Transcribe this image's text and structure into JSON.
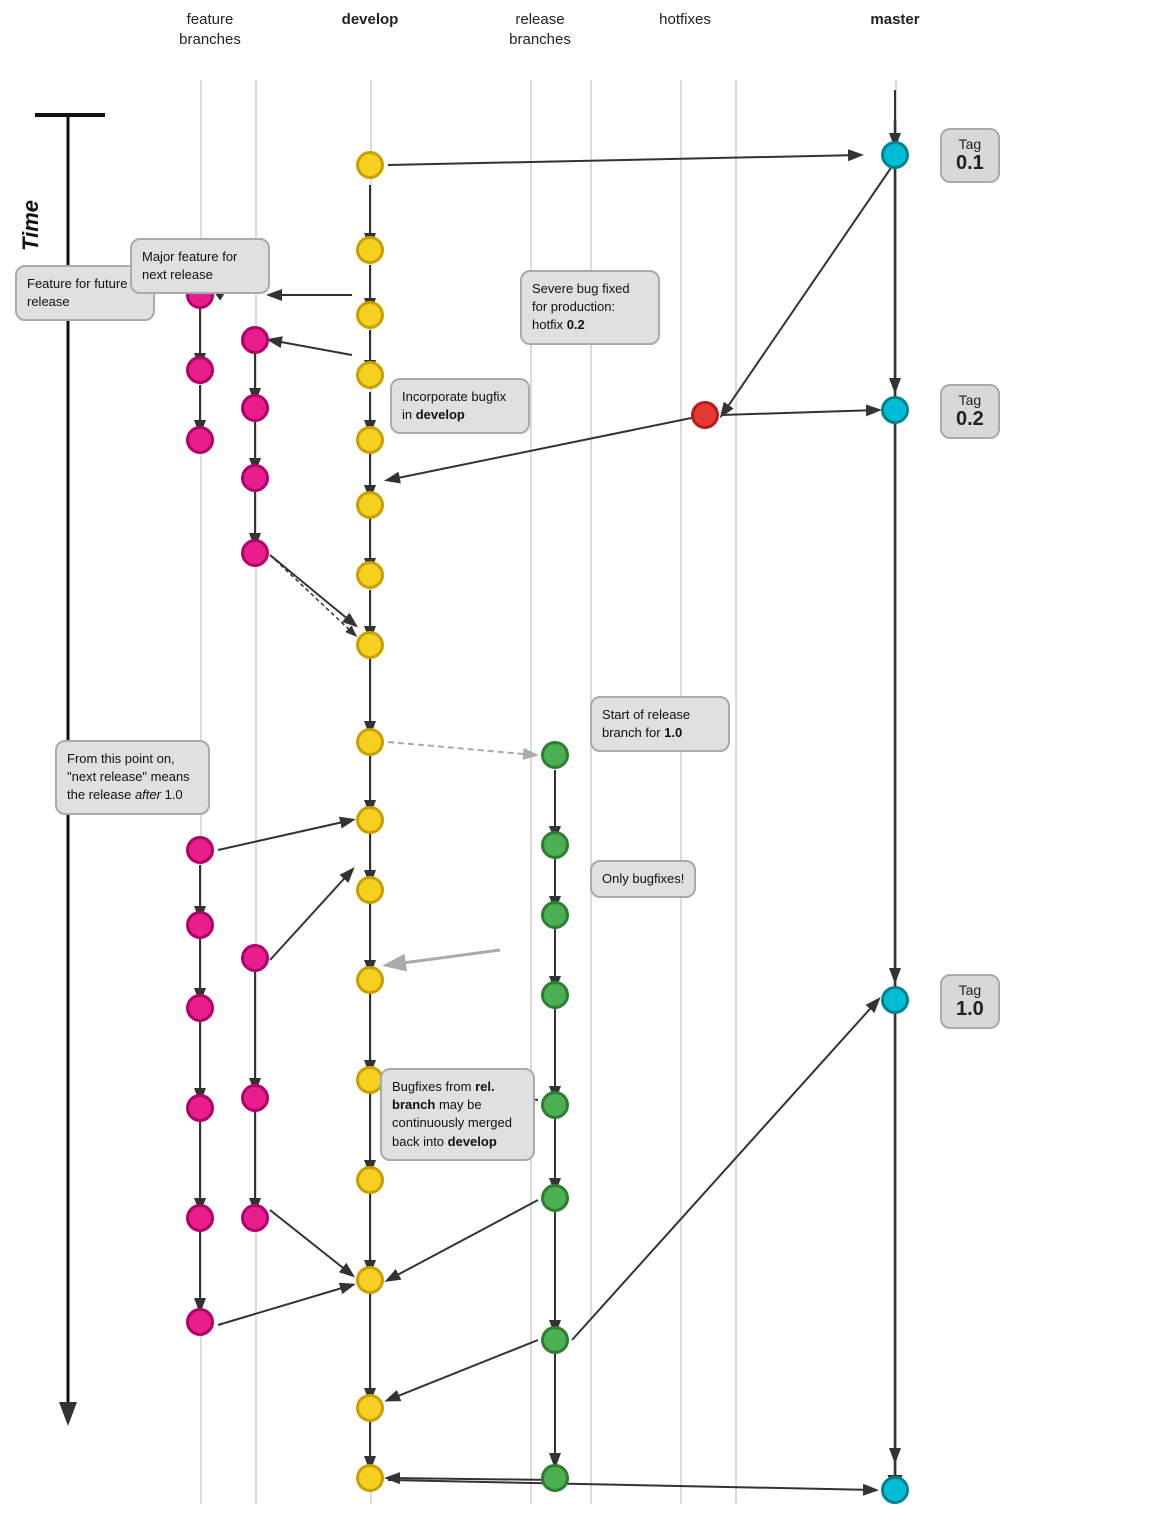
{
  "headers": {
    "feature_branches": "feature\nbranches",
    "develop": "develop",
    "release_branches": "release\nbranches",
    "hotfixes": "hotfixes",
    "master": "master",
    "time": "Time"
  },
  "tags": [
    {
      "id": "tag01",
      "label": "Tag",
      "value": "0.1"
    },
    {
      "id": "tag02",
      "label": "Tag",
      "value": "0.2"
    },
    {
      "id": "tag10",
      "label": "Tag",
      "value": "1.0"
    }
  ],
  "callouts": [
    {
      "id": "feature-future",
      "text": "Feature for future release"
    },
    {
      "id": "major-feature",
      "text": "Major feature for next release"
    },
    {
      "id": "severe-bug",
      "text": "Severe bug fixed for production: hotfix ",
      "bold": "0.2"
    },
    {
      "id": "incorporate-bugfix",
      "text": "Incorporate bugfix in ",
      "bold": "develop"
    },
    {
      "id": "start-release",
      "text": "Start of release branch for ",
      "bold": "1.0"
    },
    {
      "id": "next-release",
      "text": "From this point on, “next release” means the release ",
      "italic": "after",
      "suffix": " 1.0"
    },
    {
      "id": "only-bugfixes",
      "text": "Only bugfixes!"
    },
    {
      "id": "bugfixes-merged",
      "text": "Bugfixes from ",
      "bold_mid": "rel. branch",
      "suffix": " may be continuously merged back into ",
      "bold_end": "develop"
    }
  ],
  "colors": {
    "yellow": "#f5d020",
    "pink": "#e91e8c",
    "green": "#4caf50",
    "cyan": "#00bcd4",
    "red": "#e53935",
    "lane": "#ccc",
    "arrow": "#333",
    "arrow_gray": "#aaa"
  }
}
